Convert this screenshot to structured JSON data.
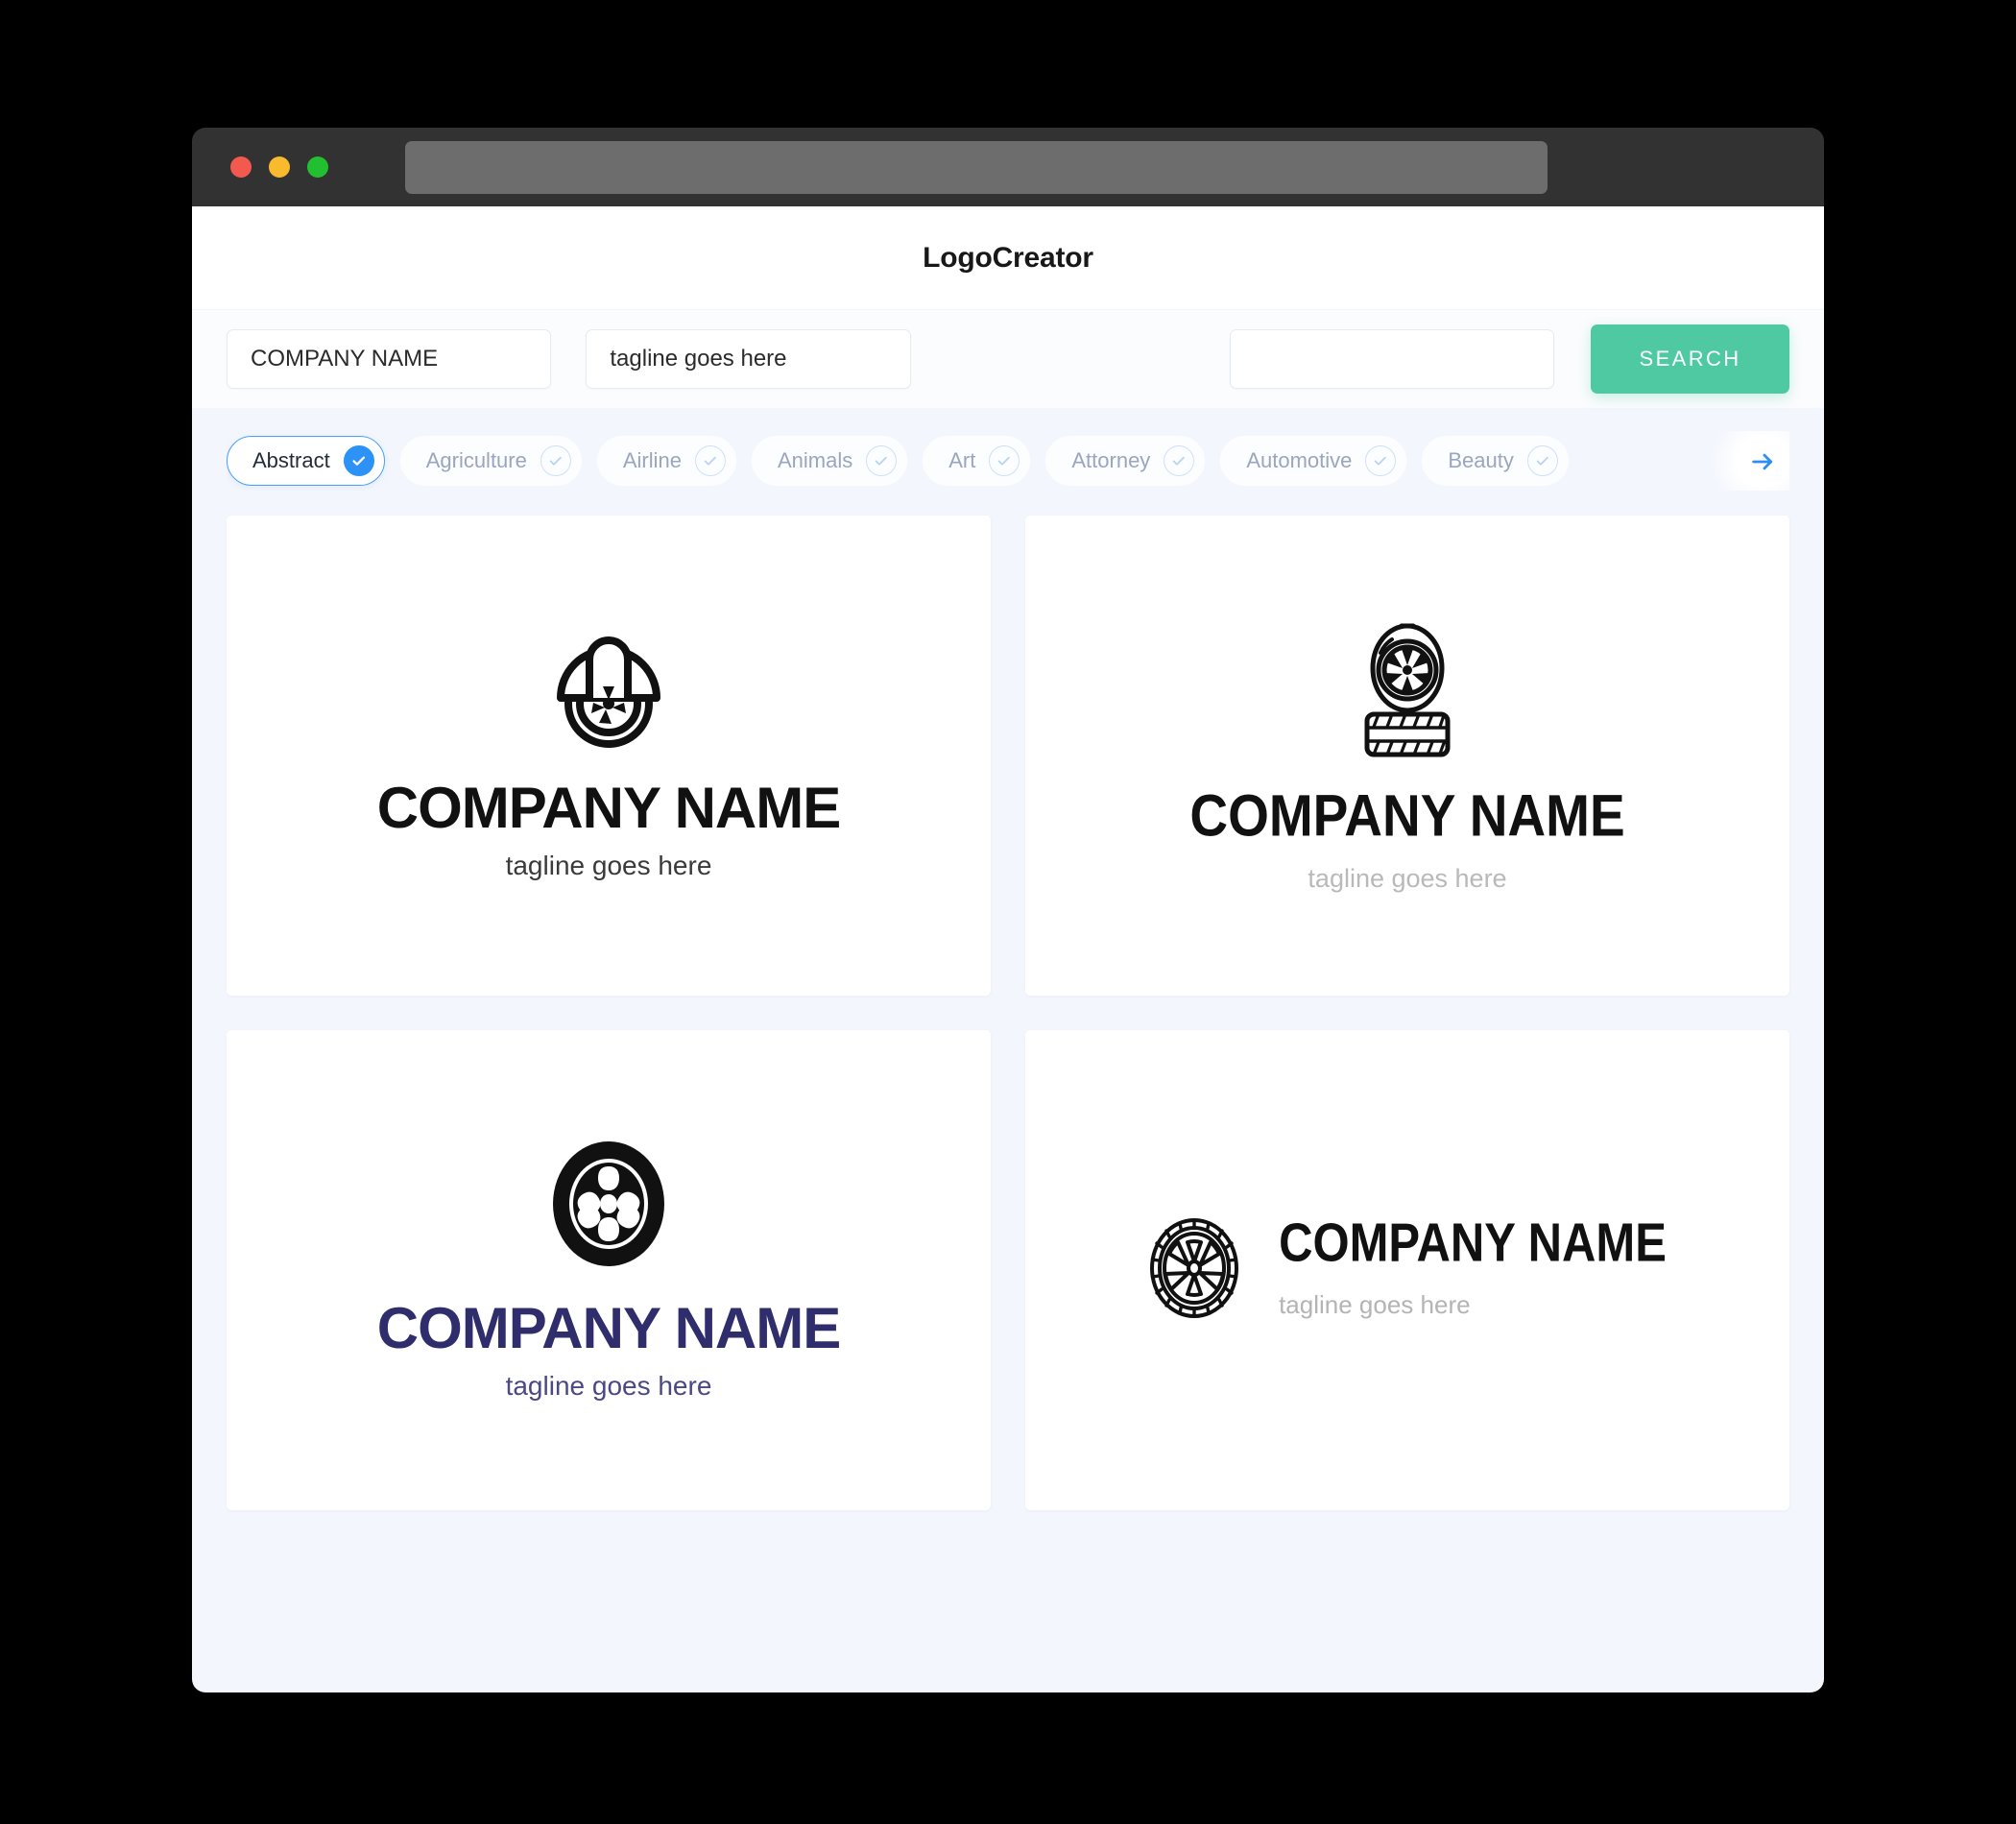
{
  "window": {
    "traffic_lights": [
      {
        "name": "close",
        "color": "#f4594f"
      },
      {
        "name": "minimize",
        "color": "#f9bb2d"
      },
      {
        "name": "maximize",
        "color": "#22c030"
      }
    ],
    "url_value": "",
    "url_placeholder": ""
  },
  "header": {
    "title": "LogoCreator"
  },
  "search": {
    "company_value": "COMPANY NAME",
    "company_placeholder": "COMPANY NAME",
    "tagline_value": "tagline goes here",
    "tagline_placeholder": "tagline goes here",
    "keyword_value": "",
    "keyword_placeholder": "",
    "button_label": "SEARCH",
    "button_color": "#4ec9a2"
  },
  "categories": {
    "active_color": "#2d92f5",
    "next_icon": "arrow-right-icon",
    "items": [
      {
        "label": "Abstract",
        "selected": true
      },
      {
        "label": "Agriculture",
        "selected": false
      },
      {
        "label": "Airline",
        "selected": false
      },
      {
        "label": "Animals",
        "selected": false
      },
      {
        "label": "Art",
        "selected": false
      },
      {
        "label": "Attorney",
        "selected": false
      },
      {
        "label": "Automotive",
        "selected": false
      },
      {
        "label": "Beauty",
        "selected": false
      }
    ]
  },
  "results": {
    "cards": [
      {
        "icon": "car-fender-wheel-icon",
        "name": "COMPANY NAME",
        "tagline": "tagline goes here",
        "layout": "vertical",
        "name_color": "#111111",
        "tagline_color": "#3a3a3a"
      },
      {
        "icon": "stacked-tire-wheel-icon",
        "name": "COMPANY NAME",
        "tagline": "tagline goes here",
        "layout": "vertical",
        "name_color": "#111111",
        "tagline_color": "#b9b9b9"
      },
      {
        "icon": "solid-tire-six-spoke-icon",
        "name": "COMPANY NAME",
        "tagline": "tagline goes here",
        "layout": "vertical",
        "name_color": "#2f2d6b",
        "tagline_color": "#4a4885"
      },
      {
        "icon": "outline-tire-tread-wheel-icon",
        "name": "COMPANY NAME",
        "tagline": "tagline goes here",
        "layout": "horizontal",
        "name_color": "#111111",
        "tagline_color": "#b4b4b4"
      }
    ]
  }
}
